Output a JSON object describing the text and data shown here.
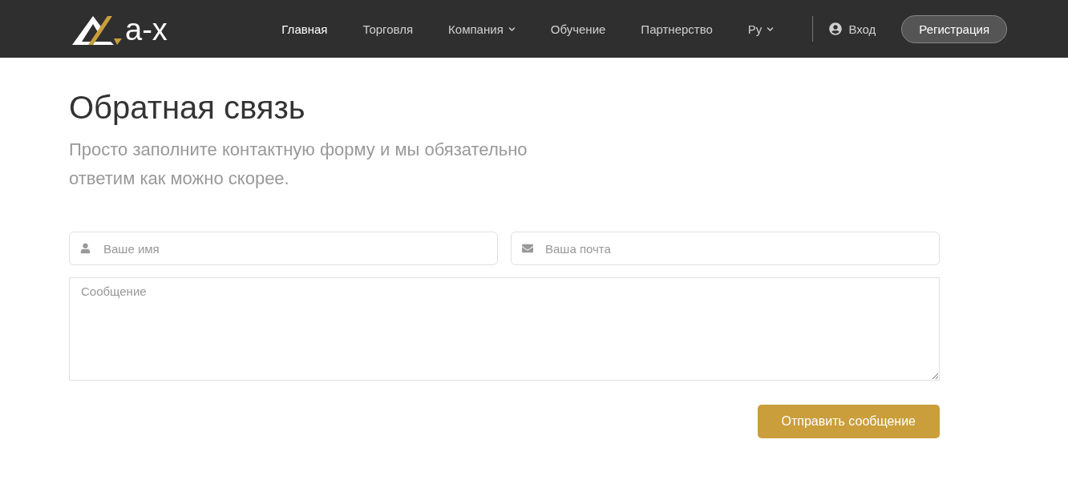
{
  "header": {
    "logo": {
      "text": "a-x"
    },
    "nav": [
      {
        "label": "Главная",
        "selected": true,
        "dropdown": false
      },
      {
        "label": "Торговля",
        "selected": false,
        "dropdown": false
      },
      {
        "label": "Компания",
        "selected": false,
        "dropdown": true
      },
      {
        "label": "Обучение",
        "selected": false,
        "dropdown": false
      },
      {
        "label": "Партнерство",
        "selected": false,
        "dropdown": false
      },
      {
        "label": "Ру",
        "selected": false,
        "dropdown": true
      }
    ],
    "login": "Вход",
    "register": "Регистрация"
  },
  "page": {
    "title": "Обратная связь",
    "subtitle": "Просто заполните контактную форму и мы обязательно ответим как можно скорее."
  },
  "form": {
    "fields": [
      {
        "kind": "name",
        "placeholder": "Ваше имя"
      },
      {
        "kind": "email",
        "placeholder": "Ваша почта"
      }
    ],
    "message": {
      "placeholder": "Сообщение"
    },
    "submit": "Отправить сообщение"
  }
}
